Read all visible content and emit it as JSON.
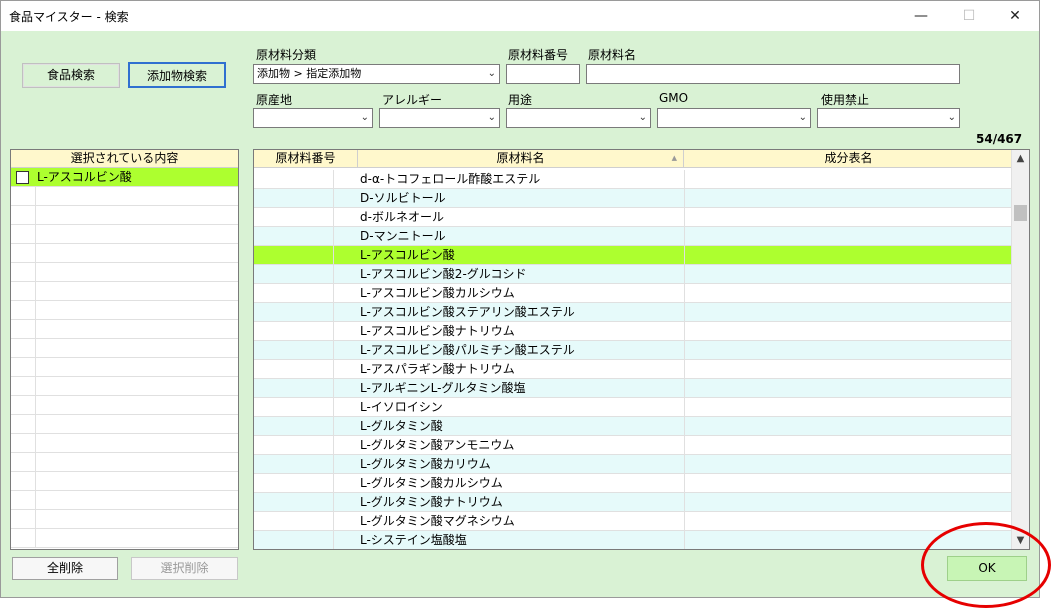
{
  "window": {
    "title": "食品マイスター - 検索",
    "minimize": "—",
    "maximize": "☐",
    "close": "✕"
  },
  "buttons": {
    "food_search": "食品検索",
    "additive_search": "添加物検索",
    "clear_all": "全削除",
    "clear_selected": "選択削除",
    "ok": "OK"
  },
  "filters": {
    "category_label": "原材料分類",
    "category_value": "添加物 > 指定添加物",
    "number_label": "原材料番号",
    "name_label": "原材料名",
    "origin_label": "原産地",
    "allergy_label": "アレルギー",
    "use_label": "用途",
    "gmo_label": "GMO",
    "banned_label": "使用禁止"
  },
  "count": "54/467",
  "selected_panel": {
    "header": "選択されている内容",
    "items": [
      "L-アスコルビン酸"
    ]
  },
  "table": {
    "headers": [
      "原材料番号",
      "原材料名",
      "成分表名"
    ],
    "sort_indicator": "▲",
    "rows": [
      {
        "name": "d-α-トコフェロール酢酸エステル",
        "selected": false
      },
      {
        "name": "D-ソルビトール",
        "selected": false
      },
      {
        "name": "d-ボルネオール",
        "selected": false
      },
      {
        "name": "D-マンニトール",
        "selected": false
      },
      {
        "name": "L-アスコルビン酸",
        "selected": true
      },
      {
        "name": "L-アスコルビン酸2-グルコシド",
        "selected": false
      },
      {
        "name": "L-アスコルビン酸カルシウム",
        "selected": false
      },
      {
        "name": "L-アスコルビン酸ステアリン酸エステル",
        "selected": false
      },
      {
        "name": "L-アスコルビン酸ナトリウム",
        "selected": false
      },
      {
        "name": "L-アスコルビン酸パルミチン酸エステル",
        "selected": false
      },
      {
        "name": "L-アスパラギン酸ナトリウム",
        "selected": false
      },
      {
        "name": "L-アルギニンL-グルタミン酸塩",
        "selected": false
      },
      {
        "name": "L-イソロイシン",
        "selected": false
      },
      {
        "name": "L-グルタミン酸",
        "selected": false
      },
      {
        "name": "L-グルタミン酸アンモニウム",
        "selected": false
      },
      {
        "name": "L-グルタミン酸カリウム",
        "selected": false
      },
      {
        "name": "L-グルタミン酸カルシウム",
        "selected": false
      },
      {
        "name": "L-グルタミン酸ナトリウム",
        "selected": false
      },
      {
        "name": "L-グルタミン酸マグネシウム",
        "selected": false
      },
      {
        "name": "L-システイン塩酸塩",
        "selected": false
      }
    ]
  },
  "colors": {
    "window_bg": "#d9f2d4",
    "header_bg": "#fff8cc",
    "row_alt": "#e6fafa",
    "row_selected": "#adff2f",
    "annotation": "#e60000"
  }
}
